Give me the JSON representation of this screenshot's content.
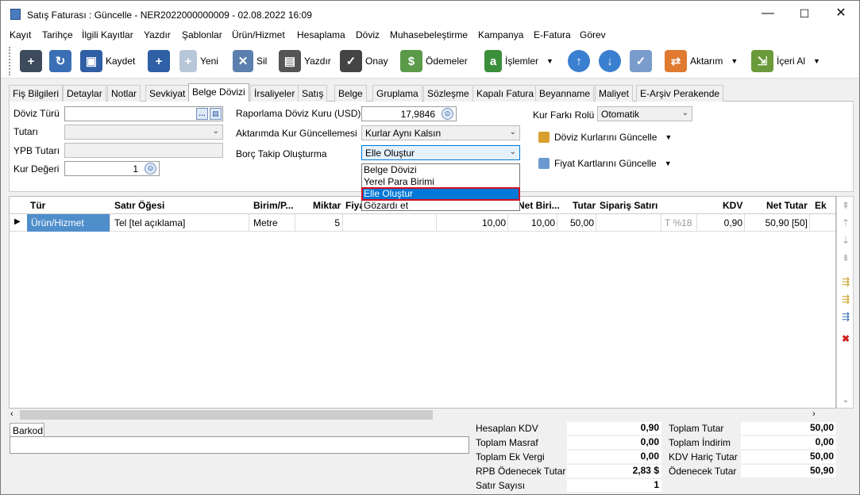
{
  "window": {
    "title": "Satış Faturası : Güncelle - NER2022000000009 - 02.08.2022 16:09",
    "minimize": "—",
    "maximize": "☐",
    "close": "✕"
  },
  "menu": [
    "Kayıt",
    "Tarihçe",
    "İlgili Kayıtlar",
    "Yazdır",
    "Şablonlar",
    "Ürün/Hizmet",
    "Hesaplama",
    "Döviz",
    "Muhasebeleştirme",
    "Kampanya",
    "E-Fatura",
    "Görev"
  ],
  "toolbar": {
    "kaydet": "Kaydet",
    "yeni": "Yeni",
    "sil": "Sil",
    "yazdir": "Yazdır",
    "onay": "Onay",
    "odemeler": "Ödemeler",
    "islemler": "İşlemler",
    "aktarim": "Aktarım",
    "iceri_al": "İçeri Al"
  },
  "tabs": [
    "Fiş Bilgileri",
    "Detaylar",
    "Notlar",
    "Sevkiyat",
    "Belge Dövizi",
    "İrsaliyeler",
    "Satış",
    "Belge",
    "Gruplama",
    "Sözleşme",
    "Kapalı Fatura",
    "Beyanname",
    "Maliyet",
    "E-Arşiv Perakende"
  ],
  "form": {
    "doviz_turu_label": "Döviz Türü",
    "tutari_label": "Tutarı",
    "ypb_tutari_label": "YPB Tutarı",
    "kur_degeri_label": "Kur Değeri",
    "kur_degeri_value": "1",
    "raporlama_label": "Raporlama Döviz Kuru (USD)",
    "raporlama_value": "17,9846",
    "aktarimda_label": "Aktarımda Kur Güncellemesi",
    "aktarimda_value": "Kurlar Aynı Kalsın",
    "borc_label": "Borç Takip Oluşturma",
    "borc_value": "Elle Oluştur",
    "kur_farki_label": "Kur Farkı Rolü",
    "kur_farki_value": "Otomatik",
    "doviz_kurlari_btn": "Döviz Kurlarını Güncelle",
    "fiyat_kartlari_btn": "Fiyat Kartlarını Güncelle"
  },
  "dropdown_options": [
    "Belge Dövizi",
    "Yerel Para Birimi",
    "Elle Oluştur",
    "Gözardı et"
  ],
  "grid": {
    "headers": [
      "Tür",
      "Satır Öğesi",
      "Birim/P...",
      "Miktar",
      "Fiya",
      "Net Biri...",
      "Tutar",
      "Sipariş Satırı",
      "KDV",
      "Net Tutar",
      "Ek"
    ],
    "row": {
      "tur": "Ürün/Hizmet",
      "satir": "Tel [tel açıklama]",
      "birim": "Metre",
      "miktar": "5",
      "fiyat": "10,00",
      "net_birim": "10,00",
      "tutar": "50,00",
      "kdv_code": "T %18",
      "kdv": "0,90",
      "net_tutar": "50,90 [50]"
    }
  },
  "barkod_label": "Barkod",
  "totals": {
    "hesaplan_kdv_label": "Hesaplan KDV",
    "hesaplan_kdv": "0,90",
    "toplam_masraf_label": "Toplam Masraf",
    "toplam_masraf": "0,00",
    "toplam_ek_vergi_label": "Toplam Ek Vergi",
    "toplam_ek_vergi": "0,00",
    "rpb_label": "RPB Ödenecek Tutar",
    "rpb": "2,83 $",
    "satir_sayisi_label": "Satır Sayısı",
    "satir_sayisi": "1",
    "toplam_tutar_label": "Toplam Tutar",
    "toplam_tutar": "50,00",
    "toplam_indirim_label": "Toplam İndirim",
    "toplam_indirim": "0,00",
    "kdv_haric_label": "KDV Hariç Tutar",
    "kdv_haric": "50,00",
    "odenecek_label": "Ödenecek Tutar",
    "odenecek": "50,90"
  }
}
